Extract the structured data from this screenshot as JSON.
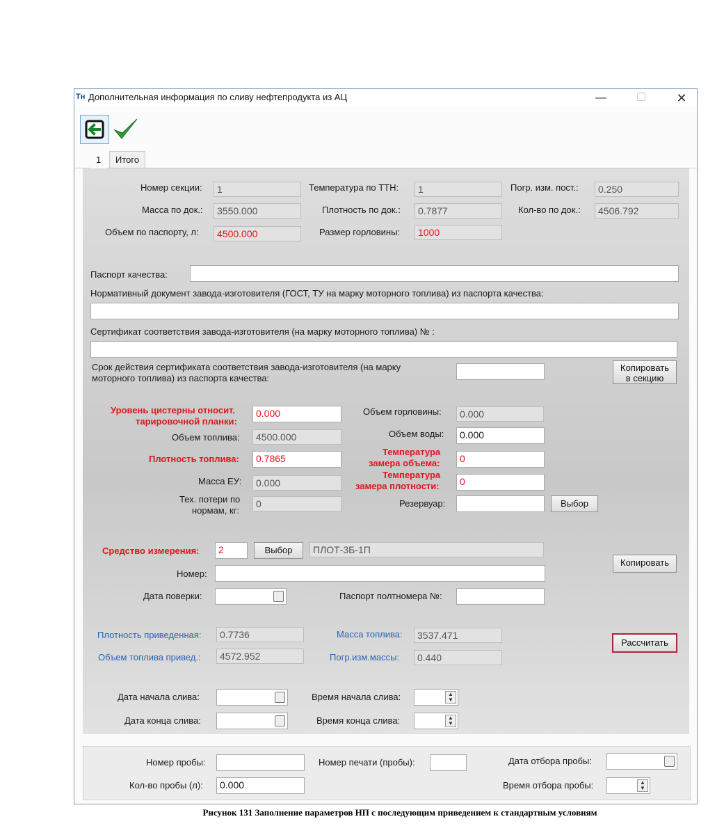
{
  "window": {
    "title": "Дополнительная информация по сливу нефтепродукта из АЦ",
    "logo": "Тн"
  },
  "tabs": [
    {
      "label": "1"
    },
    {
      "label": "Итого"
    }
  ],
  "section": {
    "section_number_label": "Номер секции:",
    "section_number": "1",
    "ttn_temp_label": "Температура по ТТН:",
    "ttn_temp": "1",
    "meas_error_label": "Погр. изм. пост.:",
    "meas_error": "0.250",
    "doc_mass_label": "Масса по док.:",
    "doc_mass": "3550.000",
    "doc_density_label": "Плотность по док.:",
    "doc_density": "0.7877",
    "doc_qty_label": "Кол-во по док.:",
    "doc_qty": "4506.792",
    "passport_volume_label": "Объем по паспорту, л:",
    "passport_volume": "4500.000",
    "neck_size_label": "Размер горловины:",
    "neck_size": "1000"
  },
  "quality": {
    "passport_label": "Паспорт качества:",
    "normative_label": "Нормативный документ завода-изготовителя (ГОСТ, ТУ на марку моторного топлива) из паспорта качества:",
    "certificate_label": "Сертификат соответствия завода-изготовителя (на марку моторного топлива) № :",
    "validity_label_1": "Срок действия сертификата соответствия завода-изготовителя (на марку",
    "validity_label_2": "моторного топлива) из паспорта качества:",
    "copy_to_section_1": "Копировать",
    "copy_to_section_2": "в секцию"
  },
  "measure": {
    "tank_level_label_1": "Уровень цистерны относит.",
    "tank_level_label_2": "тарировочной планки:",
    "tank_level": "0.000",
    "neck_volume_label": "Объем горловины:",
    "neck_volume": "0.000",
    "fuel_volume_label": "Объем топлива:",
    "fuel_volume": "4500.000",
    "water_volume_label": "Объем воды:",
    "water_volume": "0.000",
    "fuel_density_label": "Плотность топлива:",
    "fuel_density": "0.7865",
    "vol_temp_label_1": "Температура",
    "vol_temp_label_2": "замера объема:",
    "vol_temp": "0",
    "eu_mass_label": "Масса ЕУ:",
    "eu_mass": "0.000",
    "dens_temp_label_1": "Температура",
    "dens_temp_label_2": "замера плотности:",
    "dens_temp": "0",
    "tech_loss_label_1": "Тех. потери по",
    "tech_loss_label_2": "нормам, кг:",
    "tech_loss": "0",
    "reservoir_label": "Резервуар:",
    "reservoir": "",
    "select_label": "Выбор"
  },
  "instrument": {
    "label": "Средство измерения:",
    "value": "2",
    "select_label": "Выбор",
    "name": "ПЛОТ-3Б-1П",
    "copy_label": "Копировать",
    "number_label": "Номер:",
    "number": "",
    "verify_date_label": "Дата поверки:",
    "passport_label": "Паспорт полтномера №:",
    "passport": ""
  },
  "results": {
    "reduced_density_label": "Плотность приведенная:",
    "reduced_density": "0.7736",
    "fuel_mass_label": "Масса топлива:",
    "fuel_mass": "3537.471",
    "reduced_volume_label": "Объем топлива привед.:",
    "reduced_volume": "4572.952",
    "mass_error_label": "Погр.изм.массы:",
    "mass_error": "0.440",
    "calculate_label": "Рассчитать"
  },
  "drain": {
    "start_date_label": "Дата начала слива:",
    "start_time_label": "Время начала слива:",
    "end_date_label": "Дата конца слива:",
    "end_time_label": "Время конца слива:"
  },
  "sample": {
    "number_label": "Номер пробы:",
    "number": "",
    "seal_label": "Номер печати (пробы):",
    "seal": "",
    "date_label": "Дата отбора пробы:",
    "qty_label": "Кол-во пробы (л):",
    "qty": "0.000",
    "time_label": "Время отбора пробы:"
  },
  "caption": "Рисунок 131 Заполнение параметров НП с последующим приведением к стандартным условиям"
}
